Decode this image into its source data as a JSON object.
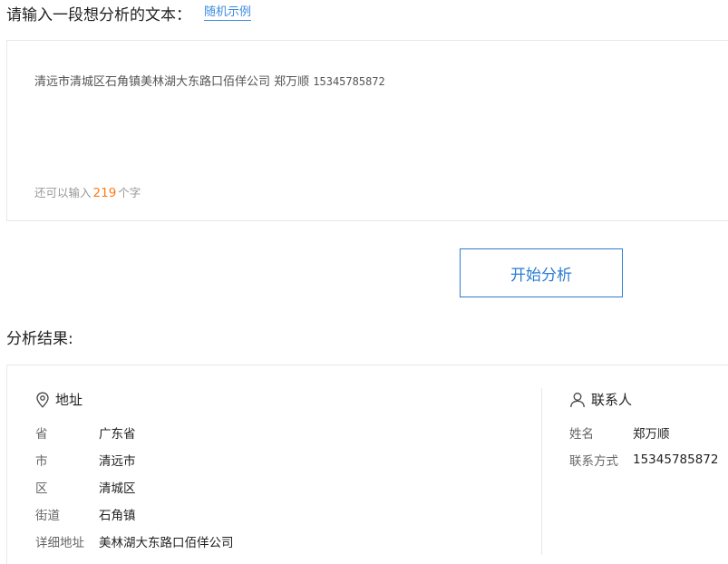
{
  "prompt": {
    "title": "请输入一段想分析的文本：",
    "random_link": "随机示例"
  },
  "input": {
    "text_main": "清远市清城区石角镇美林湖大东路口佰佯公司 郑万顺 ",
    "text_phone": "15345785872",
    "counter_prefix": "还可以输入",
    "counter_value": "219",
    "counter_suffix": "个字"
  },
  "analyze_button": "开始分析",
  "results": {
    "title": "分析结果:",
    "address": {
      "heading": "地址",
      "fields": [
        {
          "label": "省",
          "value": "广东省"
        },
        {
          "label": "市",
          "value": "清远市"
        },
        {
          "label": "区",
          "value": "清城区"
        },
        {
          "label": "街道",
          "value": "石角镇"
        },
        {
          "label": "详细地址",
          "value": "美林湖大东路口佰佯公司"
        }
      ]
    },
    "contact": {
      "heading": "联系人",
      "fields": [
        {
          "label": "姓名",
          "value": "郑万顺"
        },
        {
          "label": "联系方式",
          "value": "15345785872"
        }
      ]
    }
  },
  "colors": {
    "accent": "#2b7cd3",
    "link": "#3d8be0",
    "counter_number": "#ff7a1a",
    "border": "#e8e8e8"
  },
  "icons": {
    "address": "location-pin-icon",
    "contact": "person-icon"
  }
}
